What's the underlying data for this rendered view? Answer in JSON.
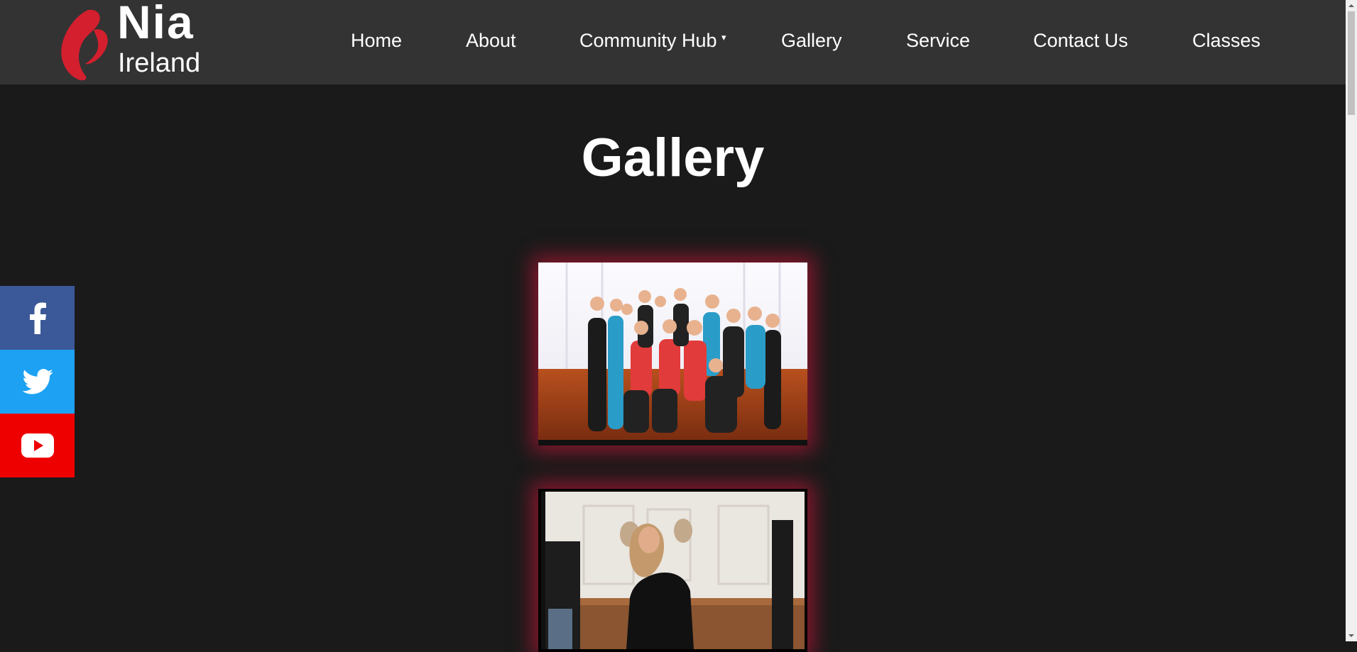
{
  "logo": {
    "line1": "Nia",
    "line2": "Ireland",
    "mark_color": "#d31f2e"
  },
  "nav": {
    "items": [
      {
        "label": "Home"
      },
      {
        "label": "About"
      },
      {
        "label": "Community Hub",
        "has_dropdown": true,
        "caret": "▾"
      },
      {
        "label": "Gallery"
      },
      {
        "label": "Service"
      },
      {
        "label": "Contact Us"
      },
      {
        "label": "Classes"
      }
    ]
  },
  "page": {
    "title": "Gallery"
  },
  "gallery": {
    "images": [
      {
        "name": "group-photo",
        "glow_color": "#dc143c"
      },
      {
        "name": "dancer-photo",
        "glow_color": "#dc143c"
      }
    ]
  },
  "social": [
    {
      "icon": "facebook-icon",
      "color": "#3b5998"
    },
    {
      "icon": "twitter-icon",
      "color": "#1da1f2"
    },
    {
      "icon": "youtube-icon",
      "color": "#ee0000"
    }
  ],
  "colors": {
    "header_bg": "#333333",
    "page_bg": "#1a1a1a",
    "text": "#ffffff"
  }
}
